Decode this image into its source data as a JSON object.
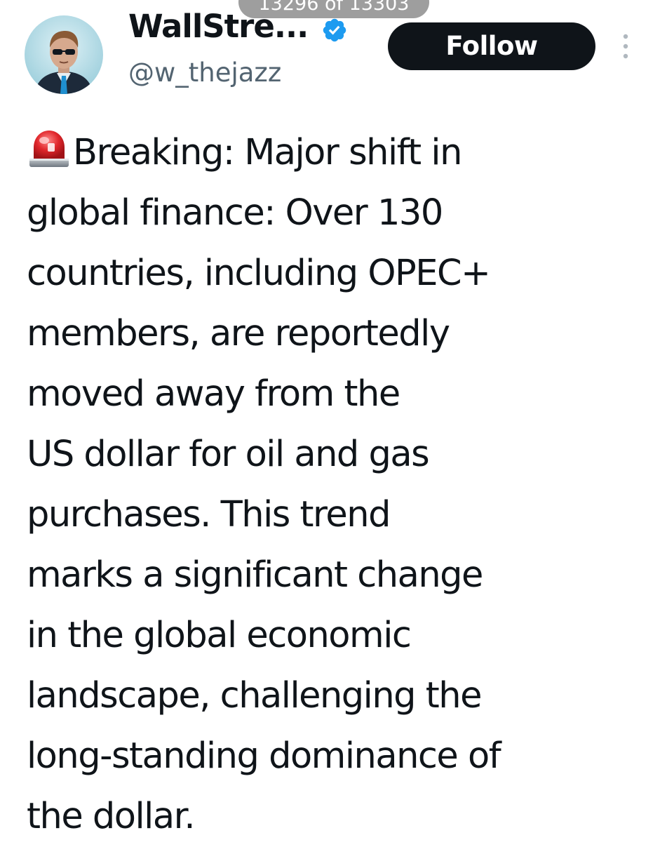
{
  "viewer": {
    "counter": "13296 of 13303"
  },
  "author": {
    "display_name": "WallStre...",
    "handle": "@w_thejazz",
    "verified_icon": "verified-badge-icon",
    "avatar_icon": "avatar"
  },
  "actions": {
    "follow_label": "Follow",
    "more_icon": "more-vertical-icon"
  },
  "tweet": {
    "leading_emoji": "police-siren-emoji",
    "lines": [
      "Breaking: Major shift in",
      "global finance: Over 130",
      "countries, including OPEC+",
      "members, are reportedly",
      "moved away from the",
      "US dollar for oil and gas",
      "purchases. This trend",
      "marks a significant change",
      "in the global economic",
      "landscape, challenging the",
      "long-standing dominance of",
      "the dollar."
    ]
  },
  "colors": {
    "text": "#0f1419",
    "secondary_text": "#536471",
    "follow_bg": "#0f1419",
    "follow_text": "#ffffff",
    "verified_blue": "#1d9bf0",
    "counter_bg": "#9e9e9e"
  }
}
